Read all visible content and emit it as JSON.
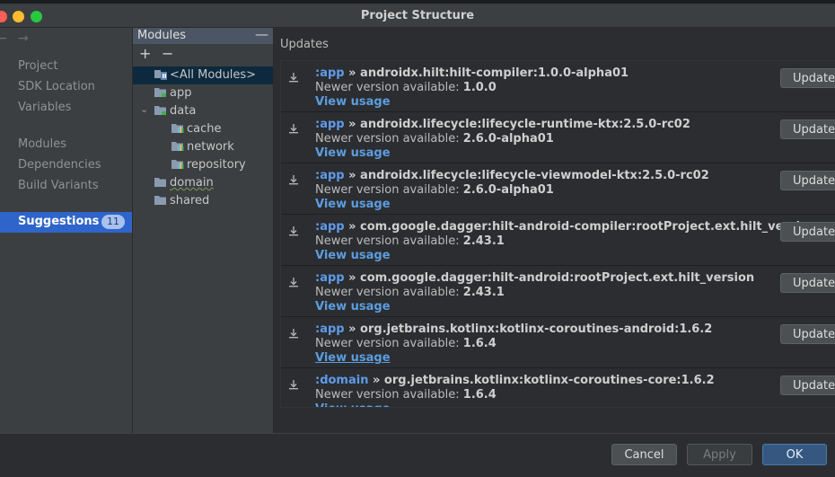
{
  "window": {
    "title": "Project Structure"
  },
  "nav": {
    "back": "←",
    "forward": "→",
    "items": [
      "Project",
      "SDK Location",
      "Variables",
      "Modules",
      "Dependencies",
      "Build Variants"
    ],
    "selected": {
      "label": "Suggestions",
      "badge": "11"
    }
  },
  "modules_panel": {
    "header": "Modules",
    "collapse": "—",
    "add": "+",
    "remove": "−",
    "tree": [
      {
        "label": "<All Modules>",
        "icon": "all-modules-icon",
        "selected": true
      },
      {
        "label": "app",
        "icon": "module-folder-icon"
      },
      {
        "label": "data",
        "icon": "module-folder-icon",
        "expanded": true
      },
      {
        "label": "cache",
        "icon": "library-icon"
      },
      {
        "label": "network",
        "icon": "library-icon"
      },
      {
        "label": "repository",
        "icon": "library-icon"
      },
      {
        "label": "domain",
        "icon": "module-folder-icon",
        "warning": true
      },
      {
        "label": "shared",
        "icon": "module-folder-icon"
      }
    ]
  },
  "updates": {
    "title": "Updates",
    "newer_prefix": "Newer version available:",
    "view_usage": "View usage",
    "update_label": "Update",
    "items": [
      {
        "module": ":app",
        "dependency": "androidx.hilt:hilt-compiler:1.0.0-alpha01",
        "version": "1.0.0"
      },
      {
        "module": ":app",
        "dependency": "androidx.lifecycle:lifecycle-runtime-ktx:2.5.0-rc02",
        "version": "2.6.0-alpha01"
      },
      {
        "module": ":app",
        "dependency": "androidx.lifecycle:lifecycle-viewmodel-ktx:2.5.0-rc02",
        "version": "2.6.0-alpha01"
      },
      {
        "module": ":app",
        "dependency": "com.google.dagger:hilt-android-compiler:rootProject.ext.hilt_version",
        "version": "2.43.1"
      },
      {
        "module": ":app",
        "dependency": "com.google.dagger:hilt-android:rootProject.ext.hilt_version",
        "version": "2.43.1"
      },
      {
        "module": ":app",
        "dependency": "org.jetbrains.kotlinx:kotlinx-coroutines-android:1.6.2",
        "version": "1.6.4",
        "link_underlined": true
      },
      {
        "module": ":domain",
        "dependency": "org.jetbrains.kotlinx:kotlinx-coroutines-core:1.6.2",
        "version": "1.6.4"
      }
    ]
  },
  "buttons": {
    "cancel": "Cancel",
    "apply": "Apply",
    "ok": "OK"
  }
}
